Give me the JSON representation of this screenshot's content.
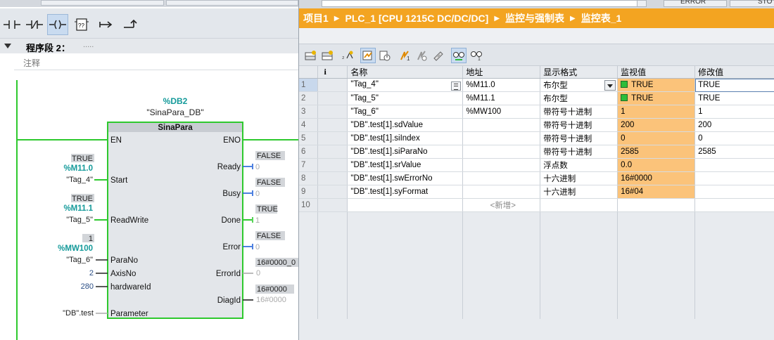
{
  "left": {
    "segment_title": "程序段 2：",
    "segment_dots": ".....",
    "comment": "注释",
    "toolbar": [
      "normally-open-contact-icon",
      "normally-closed-contact-icon",
      "coil-icon",
      "empty-box-icon",
      "open-branch-icon",
      "close-branch-icon"
    ],
    "empty_box_label": "??",
    "block": {
      "db": "%DB2",
      "db_name": "\"SinaPara_DB\"",
      "name": "SinaPara",
      "inputs": [
        "EN",
        "Start",
        "ReadWrite",
        "ParaNo",
        "AxisNo",
        "hardwareId",
        "Parameter"
      ],
      "outputs": [
        "ENO",
        "Ready",
        "Busy",
        "Done",
        "Error",
        "ErrorId",
        "DiagId"
      ]
    },
    "left_params": {
      "start_value": "TRUE",
      "start_addr": "%M11.0",
      "start_tag": "\"Tag_4\"",
      "rw_value": "TRUE",
      "rw_addr": "%M11.1",
      "rw_tag": "\"Tag_5\"",
      "parano_value": "1",
      "parano_addr": "%MW100",
      "parano_tag": "\"Tag_6\"",
      "axisno": "2",
      "hardwareid": "280",
      "parameter": "\"DB\".test"
    },
    "right_params": {
      "ready_status": "FALSE",
      "ready_val": "0",
      "busy_status": "FALSE",
      "busy_val": "0",
      "done_status": "TRUE",
      "done_val": "1",
      "error_status": "FALSE",
      "error_val": "0",
      "errorid_status": "16#0000_0",
      "errorid_val": "0",
      "diagid_status": "16#0000",
      "diagid_val": "16#0000"
    }
  },
  "right": {
    "top_strip": {
      "err": "ERROR",
      "st": "STO"
    },
    "breadcrumb": [
      "项目1",
      "PLC_1 [CPU 1215C DC/DC/DC]",
      "监控与强制表",
      "监控表_1"
    ],
    "toolbar_icons": [
      "insert-row-icon",
      "add-row-icon",
      "refresh-icon",
      "monitor-once-icon",
      "trigger-icon",
      "modify-now-icon",
      "modify-trigger-icon",
      "force-icon",
      "monitor-all-icon",
      "monitor-now-icon"
    ],
    "columns": [
      "",
      "i",
      "名称",
      "地址",
      "显示格式",
      "监视值",
      "修改值"
    ],
    "rows": [
      {
        "no": "1",
        "name": "\"Tag_4\"",
        "addr": "%M11.0",
        "fmt": "布尔型",
        "mon": "TRUE",
        "mod": "TRUE",
        "bool": true
      },
      {
        "no": "2",
        "name": "\"Tag_5\"",
        "addr": "%M11.1",
        "fmt": "布尔型",
        "mon": "TRUE",
        "mod": "TRUE",
        "bool": true
      },
      {
        "no": "3",
        "name": "\"Tag_6\"",
        "addr": "%MW100",
        "fmt": "带符号十进制",
        "mon": "1",
        "mod": "1",
        "bool": false
      },
      {
        "no": "4",
        "name": "\"DB\".test[1].sdValue",
        "addr": "",
        "fmt": "带符号十进制",
        "mon": "200",
        "mod": "200",
        "bool": false
      },
      {
        "no": "5",
        "name": "\"DB\".test[1].siIndex",
        "addr": "",
        "fmt": "带符号十进制",
        "mon": "0",
        "mod": "0",
        "bool": false
      },
      {
        "no": "6",
        "name": "\"DB\".test[1].siParaNo",
        "addr": "",
        "fmt": "带符号十进制",
        "mon": "2585",
        "mod": "2585",
        "bool": false
      },
      {
        "no": "7",
        "name": "\"DB\".test[1].srValue",
        "addr": "",
        "fmt": "浮点数",
        "mon": "0.0",
        "mod": "",
        "bool": false
      },
      {
        "no": "8",
        "name": "\"DB\".test[1].swErrorNo",
        "addr": "",
        "fmt": "十六进制",
        "mon": "16#0000",
        "mod": "",
        "bool": false
      },
      {
        "no": "9",
        "name": "\"DB\".test[1].syFormat",
        "addr": "",
        "fmt": "十六进制",
        "mon": "16#04",
        "mod": "",
        "bool": false
      }
    ],
    "new_row": {
      "no": "10",
      "label": "<新增>"
    }
  }
}
